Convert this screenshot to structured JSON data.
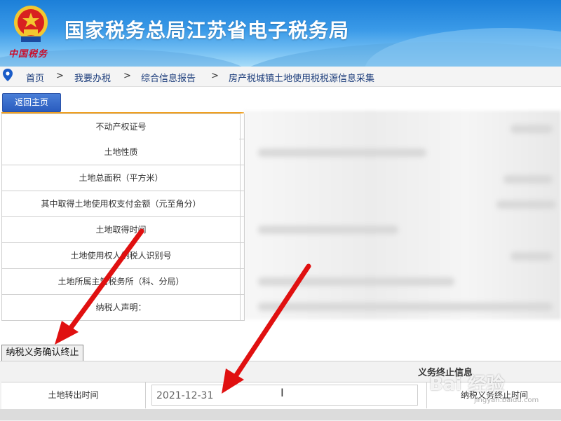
{
  "header": {
    "title": "国家税务总局江苏省电子税务局",
    "emblem_caption": "中国税务"
  },
  "breadcrumb": {
    "items": [
      "首页",
      "我要办税",
      "综合信息报告",
      "房产税城镇土地使用税税源信息采集"
    ],
    "separator": ">"
  },
  "buttons": {
    "back_home": "返回主页",
    "confirm_termination": "纳税义务确认终止"
  },
  "form": {
    "fields": [
      {
        "label": "不动产权证号"
      },
      {
        "label": "土地性质"
      },
      {
        "label": "土地总面积（平方米）"
      },
      {
        "label": "其中取得土地使用权支付金额（元至角分）"
      },
      {
        "label": "土地取得时间"
      },
      {
        "label": "土地使用权人纳税人识别号"
      },
      {
        "label": "土地所属主管税务所（科、分局）"
      },
      {
        "label": "纳税人声明："
      }
    ]
  },
  "termination": {
    "section_title": "义务终止信息",
    "transfer_time_label": "土地转出时间",
    "transfer_time_value": "2021-12-31",
    "end_time_label": "纳税义务终止时间"
  },
  "watermark": {
    "text": "Bai 经验",
    "sub": "jingyan.baidu.com"
  },
  "colors": {
    "banner_top": "#1c7fd8",
    "banner_bottom": "#a8dcf8",
    "back_button": "#2a5cbf",
    "accent_line": "#f0a020",
    "arrow": "#e01010"
  }
}
